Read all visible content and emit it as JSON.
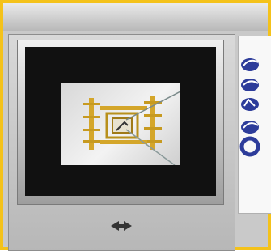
{
  "window": {
    "title": ""
  },
  "viewer": {
    "preview_name": "electrode-assembly-preview"
  },
  "nav_control": {
    "label": ""
  },
  "side_list": {
    "items": [
      {
        "name": "thumb-item-1"
      },
      {
        "name": "thumb-item-2"
      },
      {
        "name": "thumb-item-3"
      },
      {
        "name": "thumb-item-4"
      },
      {
        "name": "thumb-item-5"
      }
    ]
  },
  "colors": {
    "frame_accent": "#f4c21a",
    "panel_gray": "#c9c9c9",
    "screen_bg": "#111111",
    "icon_blue": "#2d3c9a",
    "specimen_gold": "#d4a62a"
  }
}
